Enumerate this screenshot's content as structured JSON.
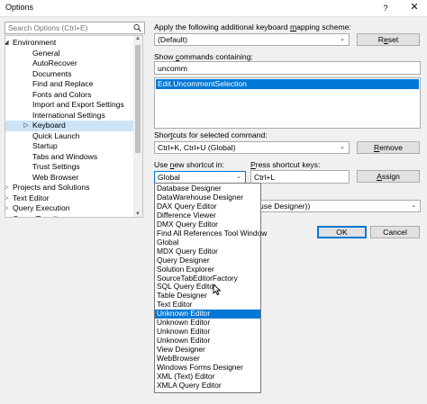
{
  "window": {
    "title": "Options",
    "help_glyph": "?",
    "close_glyph": "✕"
  },
  "search": {
    "placeholder": "Search Options (Ctrl+E)"
  },
  "tree": {
    "items": [
      {
        "label": "Environment",
        "level": 0,
        "expanded": true
      },
      {
        "label": "General",
        "level": 1
      },
      {
        "label": "AutoRecover",
        "level": 1
      },
      {
        "label": "Documents",
        "level": 1
      },
      {
        "label": "Find and Replace",
        "level": 1
      },
      {
        "label": "Fonts and Colors",
        "level": 1
      },
      {
        "label": "Import and Export Settings",
        "level": 1
      },
      {
        "label": "International Settings",
        "level": 1
      },
      {
        "label": "Keyboard",
        "level": 1,
        "selected": true,
        "expandable": true
      },
      {
        "label": "Quick Launch",
        "level": 1
      },
      {
        "label": "Startup",
        "level": 1
      },
      {
        "label": "Tabs and Windows",
        "level": 1
      },
      {
        "label": "Trust Settings",
        "level": 1
      },
      {
        "label": "Web Browser",
        "level": 1
      },
      {
        "label": "Projects and Solutions",
        "level": 0,
        "expandable": true
      },
      {
        "label": "Text Editor",
        "level": 0,
        "expandable": true
      },
      {
        "label": "Query Execution",
        "level": 0,
        "expandable": true
      },
      {
        "label": "Query Results",
        "level": 0,
        "expandable": true
      }
    ]
  },
  "mapping": {
    "label_pre": "Apply the following additional keyboard ",
    "label_u": "m",
    "label_post": "apping scheme:",
    "value": "(Default)",
    "reset_pre": "R",
    "reset_u": "e",
    "reset_post": "set"
  },
  "show_commands": {
    "label_pre": "Show ",
    "label_u": "c",
    "label_post": "ommands containing:",
    "value": "uncomm",
    "results": [
      "Edit.UncommentSelection"
    ]
  },
  "shortcuts": {
    "label_pre": "Shor",
    "label_u": "t",
    "label_post": "cuts for selected command:",
    "value": "Ctrl+K, Ctrl+U (Global)",
    "remove_pre": "",
    "remove_u": "R",
    "remove_post": "emove"
  },
  "use_new": {
    "label_pre": "Use ",
    "label_u": "n",
    "label_post": "ew shortcut in:",
    "value": "Global"
  },
  "press_keys": {
    "label_pre": "",
    "label_u": "P",
    "label_post": "ress shortcut keys:",
    "value": "Ctrl+L",
    "assign_pre": "",
    "assign_u": "A",
    "assign_post": "ssign"
  },
  "currently_used": {
    "value_partial": "use Designer))"
  },
  "footer": {
    "ok": "OK",
    "cancel": "Cancel"
  },
  "dropdown": {
    "highlighted_index": 14,
    "options": [
      "Database Designer",
      "DataWarehouse Designer",
      "DAX Query Editor",
      "Difference Viewer",
      "DMX Query Editor",
      "Find All References Tool Window",
      "Global",
      "MDX Query Editor",
      "Query Designer",
      "Solution Explorer",
      "SourceTabEditorFactory",
      "SQL Query Editor",
      "Table Designer",
      "Text Editor",
      "Unknown Editor",
      "Unknown Editor",
      "Unknown Editor",
      "Unknown Editor",
      "View Designer",
      "WebBrowser",
      "Windows Forms Designer",
      "XML (Text) Editor",
      "XMLA Query Editor"
    ]
  },
  "icons": {
    "search": "search-icon",
    "chevron": "chevron-down-icon",
    "expand": "expand-arrow-icon",
    "collapse": "collapse-arrow-icon",
    "cursor": "mouse-pointer-icon"
  },
  "colors": {
    "accent": "#0078d7",
    "selection_light": "#cce4f7"
  }
}
